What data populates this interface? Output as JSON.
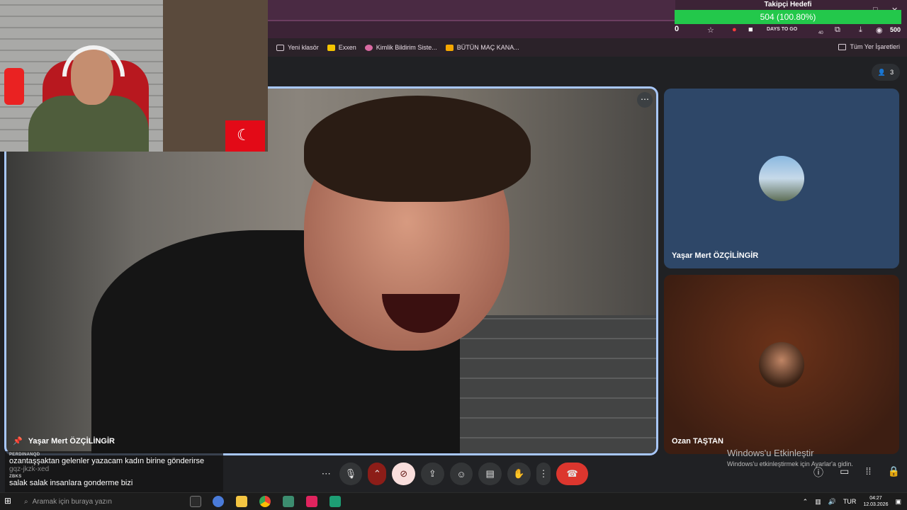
{
  "goal_widget": {
    "title": "Takipçi Hedefi",
    "bar_text": "504 (100.80%)",
    "current_count": "0",
    "max_count": "500",
    "accent_color": "#23c84b"
  },
  "browser": {
    "ext_label": "DAYS TO GO",
    "ext_badge": "40",
    "bookmarks": [
      {
        "label": "Yeni klasör",
        "icon": "folder-icon"
      },
      {
        "label": "Exxen",
        "icon": "exxen-icon"
      },
      {
        "label": "Kimlik Bildirim Siste...",
        "icon": "link-icon"
      },
      {
        "label": "BÜTÜN MAÇ KANA...",
        "icon": "jp-icon"
      }
    ],
    "all_bookmarks_label": "Tüm Yer İşaretleri"
  },
  "meeting": {
    "participant_count": "3",
    "main_speaker": "Yaşar Mert ÖZÇİLİNGİR",
    "tiles": [
      {
        "name": "Yaşar Mert ÖZÇİLİNGİR"
      },
      {
        "name": "Ozan TAŞTAN"
      }
    ]
  },
  "controls": {
    "icons": [
      "more-options-icon",
      "microphone-icon",
      "chevron-up-icon",
      "camera-off-icon",
      "present-screen-icon",
      "emoji-icon",
      "captions-icon",
      "raise-hand-icon",
      "more-vert-icon",
      "end-call-icon"
    ]
  },
  "activation": {
    "title": "Windows'u Etkinleştir",
    "subtitle": "Windows'u etkinleştirmek için Ayarlar'a gidin."
  },
  "chat": [
    {
      "user": "PERDINANQD",
      "message": "ozantaşşaktan gelenler yazacam kadın birine gönderirse"
    },
    {
      "user": "",
      "message": "gqz-jkzk-xed"
    },
    {
      "user": "ZBKS",
      "message": "salak salak insanlara gonderme bizi"
    }
  ],
  "taskbar": {
    "search_placeholder": "Aramak için buraya yazın",
    "language": "TUR",
    "time": "04:27",
    "date": "12.03.2026"
  }
}
